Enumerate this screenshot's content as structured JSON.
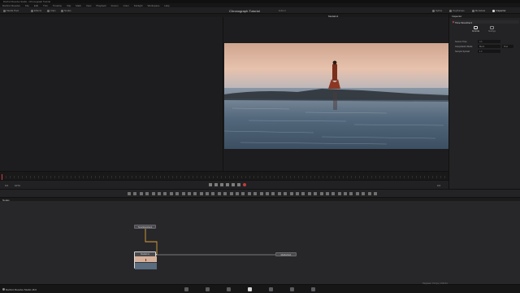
{
  "window": {
    "title": "DaVinci Resolve Studio - Chronograph Tutorial"
  },
  "menu": {
    "items": [
      "DaVinci Resolve",
      "File",
      "Edit",
      "Trim",
      "Timeline",
      "Clip",
      "Mark",
      "View",
      "Playback",
      "Fusion",
      "Color",
      "Fairlight",
      "Workspace",
      "Help"
    ]
  },
  "toolbar": {
    "media_pool": "Media Pool",
    "effects": "Effects",
    "clips": "Clips",
    "nodes": "Nodes",
    "project_title": "Chronograph Tutorial",
    "edited": "Edited",
    "workspaces": [
      {
        "label": "Spline",
        "icon": "spline-icon"
      },
      {
        "label": "Keyframes",
        "icon": "keyframes-icon"
      },
      {
        "label": "Metadata",
        "icon": "metadata-icon"
      },
      {
        "label": "Inspector",
        "icon": "inspector-icon",
        "active": true
      }
    ]
  },
  "viewer": {
    "name": "MediaIn1"
  },
  "inspector": {
    "title": "Inspector",
    "tool_name": "Time Stretcher1",
    "tabs": [
      "Controls",
      "Settings"
    ],
    "rows": [
      {
        "label": "Source Time",
        "value": "0.0"
      },
      {
        "label": "Interpolation Mode",
        "value": "Blend",
        "value2": "Flow"
      },
      {
        "label": "Sample Spread",
        "value": "1.0"
      }
    ]
  },
  "transport": {
    "left": "0.0",
    "frame": "1074",
    "right": "0.0"
  },
  "nodes": {
    "header": "Nodes",
    "items": [
      {
        "label": "TimeStretcher1"
      },
      {
        "label": "MediaIn1"
      },
      {
        "label": "MediaOut1"
      }
    ]
  },
  "status": {
    "app_name": "DaVinci Resolve Studio 18.6",
    "right_text": "Playback: 1% fps | 0:00:44"
  },
  "colors": {
    "accent": "#d9a23a",
    "playhead": "#d83b3b",
    "sky_top": "#c9a48a",
    "sea": "#5d7386"
  }
}
